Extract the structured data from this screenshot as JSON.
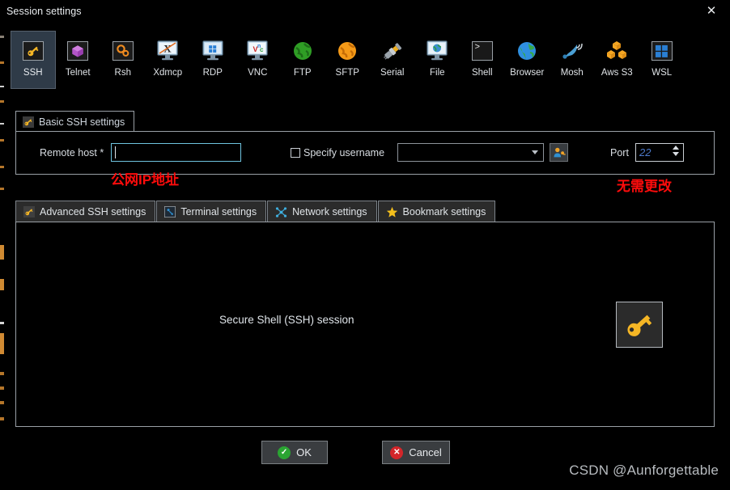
{
  "window": {
    "title": "Session settings",
    "close_label": "✕"
  },
  "protocols": [
    {
      "label": "SSH",
      "icon": "key-icon",
      "selected": true
    },
    {
      "label": "Telnet",
      "icon": "cube-icon",
      "selected": false
    },
    {
      "label": "Rsh",
      "icon": "gears-icon",
      "selected": false
    },
    {
      "label": "Xdmcp",
      "icon": "x-monitor-icon",
      "selected": false
    },
    {
      "label": "RDP",
      "icon": "windows-monitor-icon",
      "selected": false
    },
    {
      "label": "VNC",
      "icon": "vnc-monitor-icon",
      "selected": false
    },
    {
      "label": "FTP",
      "icon": "green-globe-icon",
      "selected": false
    },
    {
      "label": "SFTP",
      "icon": "orange-globe-icon",
      "selected": false
    },
    {
      "label": "Serial",
      "icon": "serial-plug-icon",
      "selected": false
    },
    {
      "label": "File",
      "icon": "file-monitor-icon",
      "selected": false
    },
    {
      "label": "Shell",
      "icon": "terminal-prompt-icon",
      "selected": false
    },
    {
      "label": "Browser",
      "icon": "blue-globe-icon",
      "selected": false
    },
    {
      "label": "Mosh",
      "icon": "satellite-dish-icon",
      "selected": false
    },
    {
      "label": "Aws S3",
      "icon": "aws-cubes-icon",
      "selected": false
    },
    {
      "label": "WSL",
      "icon": "windows-logo-icon",
      "selected": false
    }
  ],
  "basic": {
    "tab_label": "Basic SSH settings",
    "tab_icon": "key-icon",
    "remote_host_label": "Remote host *",
    "remote_host_value": "",
    "remote_host_placeholder": "",
    "specify_username_label": "Specify username",
    "specify_username_checked": false,
    "username_value": "",
    "username_placeholder": "",
    "user_button_icon": "user-key-icon",
    "port_label": "Port",
    "port_value": "22"
  },
  "advanced_tabs": [
    {
      "label": "Advanced SSH settings",
      "icon": "key-icon",
      "active": true
    },
    {
      "label": "Terminal settings",
      "icon": "terminal-icon",
      "active": false
    },
    {
      "label": "Network settings",
      "icon": "network-icon",
      "active": false
    },
    {
      "label": "Bookmark settings",
      "icon": "star-icon",
      "active": false
    }
  ],
  "content": {
    "session_caption": "Secure Shell (SSH) session",
    "session_icon": "key-icon"
  },
  "footer": {
    "ok_label": "OK",
    "ok_icon": "check-circle-icon",
    "cancel_label": "Cancel",
    "cancel_icon": "x-circle-icon",
    "watermark": "CSDN @Aunforgettable"
  },
  "annotations": [
    {
      "text": "公网IP地址",
      "color": "#ff0c0c"
    },
    {
      "text": "无需更改",
      "color": "#ff0c0c"
    }
  ],
  "colors": {
    "background": "#000000",
    "selected_tab": "#2f3b48",
    "border": "#9aa0a6",
    "focus_border": "#6fc4e0",
    "accent_key": "#f5b625",
    "annotation_red": "#ff0c0c"
  }
}
